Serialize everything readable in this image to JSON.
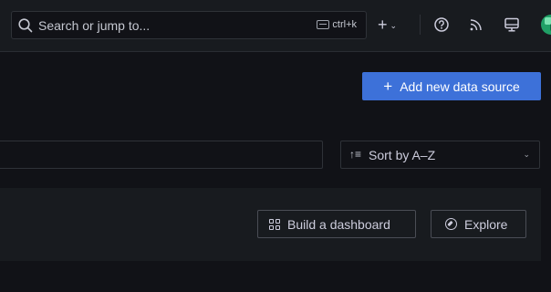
{
  "topbar": {
    "search_placeholder": "Search or jump to...",
    "shortcut": "ctrl+k",
    "new_label": "+",
    "new_chevron": "⌄"
  },
  "header": {
    "add_button": "Add new data source",
    "add_plus": "+"
  },
  "filters": {
    "search_value": "",
    "sort_icon": "↑≡",
    "sort_label": "Sort by A–Z",
    "sort_chevron": "⌄"
  },
  "actions": {
    "build_dashboard": "Build a dashboard",
    "explore": "Explore"
  },
  "icons": [
    "search-icon",
    "keyboard-icon",
    "help-icon",
    "rss-icon",
    "monitor-icon",
    "avatar",
    "dashboard-grid-icon",
    "compass-icon"
  ],
  "colors": {
    "background": "#111217",
    "surface": "#181b1f",
    "primary": "#3d71d9",
    "text": "#ccccdc"
  }
}
